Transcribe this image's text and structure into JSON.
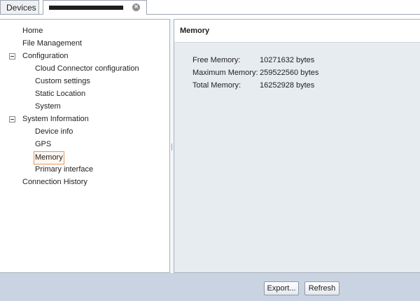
{
  "tabs": {
    "devices_label": "Devices",
    "close_icon": "close-icon"
  },
  "tree": {
    "items": [
      {
        "label": "Home"
      },
      {
        "label": "File Management"
      },
      {
        "label": "Configuration",
        "expanded": true
      },
      {
        "label": "Cloud Connector configuration"
      },
      {
        "label": "Custom settings"
      },
      {
        "label": "Static Location"
      },
      {
        "label": "System"
      },
      {
        "label": "System Information",
        "expanded": true
      },
      {
        "label": "Device info"
      },
      {
        "label": "GPS"
      },
      {
        "label": "Memory",
        "selected": true
      },
      {
        "label": "Primary interface"
      },
      {
        "label": "Connection History"
      }
    ]
  },
  "panel": {
    "title": "Memory",
    "rows": [
      {
        "key": "Free Memory:",
        "value": "10271632 bytes"
      },
      {
        "key": "Maximum Memory:",
        "value": "259522560 bytes"
      },
      {
        "key": "Total Memory:",
        "value": "16252928 bytes"
      }
    ]
  },
  "actions": {
    "export_label": "Export...",
    "refresh_label": "Refresh"
  },
  "colors": {
    "selection_border": "#e39a5e",
    "bottom_bar": "#c9d3e2",
    "panel_background": "#e7ecf1"
  }
}
